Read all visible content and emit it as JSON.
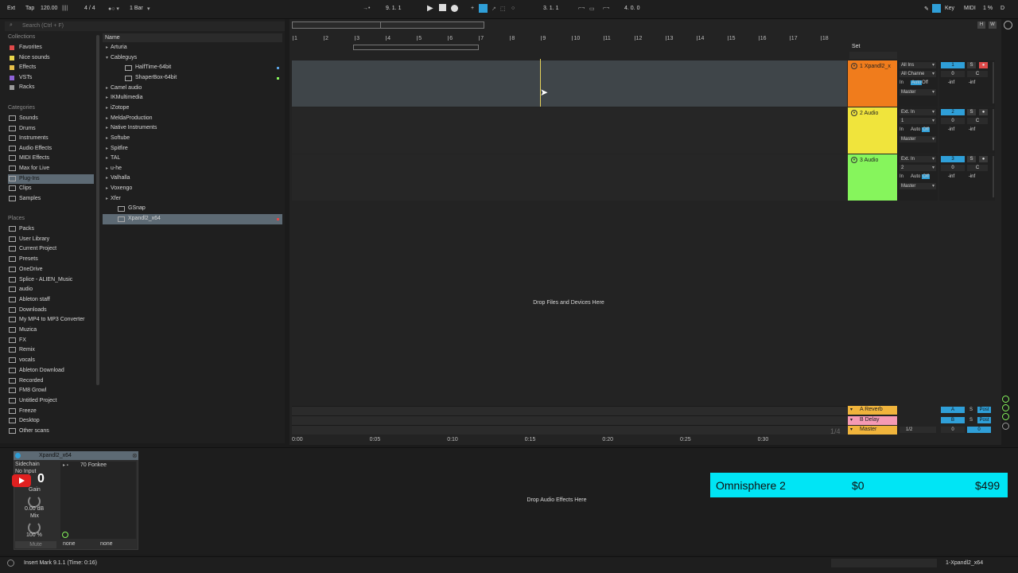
{
  "transport": {
    "ext": "Ext",
    "tap": "Tap",
    "tempo": "120.00",
    "signature": "4 / 4",
    "quantize": "1 Bar",
    "arr_position": "9.  1.  1",
    "loop_start": "3.  1.  1",
    "loop_length": "4.  0.  0",
    "key": "Key",
    "midi": "MIDI",
    "cpu": "1 %",
    "disk": "D"
  },
  "browser": {
    "search_placeholder": "Search (Ctrl + F)",
    "collections_title": "Collections",
    "collections": [
      {
        "label": "Favorites",
        "color": "#e04a4a"
      },
      {
        "label": "Nice sounds",
        "color": "#e8d54a"
      },
      {
        "label": "Effects",
        "color": "#e8c04a"
      },
      {
        "label": "VSTs",
        "color": "#8f63d8"
      },
      {
        "label": "Racks",
        "color": "#9a9a9a"
      }
    ],
    "categories_title": "Categories",
    "categories": [
      "Sounds",
      "Drums",
      "Instruments",
      "Audio Effects",
      "MIDI Effects",
      "Max for Live",
      "Plug-Ins",
      "Clips",
      "Samples"
    ],
    "places_title": "Places",
    "places": [
      "Packs",
      "User Library",
      "Current Project",
      "Presets",
      "OneDrive",
      "Splice - ALIEN_Music",
      "audio",
      "Ableton staff",
      "Downloads",
      "My MP4 to MP3 Converter",
      "Muzica",
      "FX",
      "Remix",
      "vocals",
      "Ableton Download",
      "Recorded",
      "FM8 Growl",
      "Untitled Project",
      "Freeze",
      "Desktop",
      "Other scans"
    ],
    "name_header": "Name",
    "tree": [
      {
        "label": "Arturia",
        "type": "folder",
        "indent": 0
      },
      {
        "label": "Cableguys",
        "type": "open",
        "indent": 0
      },
      {
        "label": "HalfTime-64bit",
        "type": "plugin",
        "indent": 2
      },
      {
        "label": "ShaperBox-64bit",
        "type": "plugin",
        "indent": 2
      },
      {
        "label": "Camel audio",
        "type": "folder",
        "indent": 0
      },
      {
        "label": "IKMultimedia",
        "type": "folder",
        "indent": 0
      },
      {
        "label": "iZotope",
        "type": "folder",
        "indent": 0
      },
      {
        "label": "MeldaProduction",
        "type": "folder",
        "indent": 0
      },
      {
        "label": "Native Instruments",
        "type": "folder",
        "indent": 0
      },
      {
        "label": "Softube",
        "type": "folder",
        "indent": 0
      },
      {
        "label": "Spitfire",
        "type": "folder",
        "indent": 0
      },
      {
        "label": "TAL",
        "type": "folder",
        "indent": 0
      },
      {
        "label": "u-he",
        "type": "folder",
        "indent": 0
      },
      {
        "label": "Valhalla",
        "type": "folder",
        "indent": 0
      },
      {
        "label": "Voxengo",
        "type": "folder",
        "indent": 0
      },
      {
        "label": "Xfer",
        "type": "folder",
        "indent": 0
      },
      {
        "label": "GSnap",
        "type": "plugin",
        "indent": 1
      },
      {
        "label": "Xpandl2_x64",
        "type": "plugin",
        "indent": 1
      }
    ]
  },
  "arrangement": {
    "bars": [
      "1",
      "2",
      "3",
      "4",
      "5",
      "6",
      "7",
      "8",
      "9",
      "10",
      "11",
      "12",
      "13",
      "14",
      "15",
      "16",
      "17",
      "18"
    ],
    "set_label": "Set",
    "drop_text": "Drop Files and Devices Here",
    "times": [
      "0:00",
      "0:05",
      "0:10",
      "0:15",
      "0:20",
      "0:25",
      "0:30"
    ],
    "zoom_ratio": "1/4"
  },
  "tracks": [
    {
      "name": "1 Xpandl2_x",
      "color": "#f07c1c",
      "input": "All Ins",
      "channel": "All Channe",
      "monitor": [
        "In",
        "Auto",
        "Off"
      ],
      "output": "Master",
      "number": "1",
      "vol": "0",
      "pan": "C",
      "peak": "-inf"
    },
    {
      "name": "2 Audio",
      "color": "#f0e43c",
      "input": "Ext. In",
      "channel": "1",
      "monitor": [
        "In",
        "Auto",
        "Off"
      ],
      "output": "Master",
      "number": "2",
      "vol": "0",
      "pan": "C",
      "peak": "-inf"
    },
    {
      "name": "3 Audio",
      "color": "#86f55c",
      "input": "Ext. In",
      "channel": "2",
      "monitor": [
        "In",
        "Auto",
        "Off"
      ],
      "output": "Master",
      "number": "3",
      "vol": "0",
      "pan": "C",
      "peak": "-inf"
    }
  ],
  "returns": [
    {
      "name": "A Reverb",
      "color": "#f0b43c",
      "letter": "A",
      "solo": "S",
      "post": "Post"
    },
    {
      "name": "B Delay",
      "color": "#f59ab4",
      "letter": "B",
      "solo": "S",
      "post": "Post"
    },
    {
      "name": "Master",
      "color": "#f0b43c",
      "output": "1/2",
      "vol": "0",
      "pan": "0"
    }
  ],
  "device": {
    "name": "Xpandl2_x64",
    "sidechain": "Sidechain",
    "sidechain_input": "No Input",
    "gain_label": "Gain",
    "gain_value": "0.00 dB",
    "mix_label": "Mix",
    "mix_value": "100 %",
    "mute": "Mute",
    "preset": "70 Fonkee",
    "slot_a": "none",
    "slot_b": "none"
  },
  "detail": {
    "fx_drop": "Drop Audio Effects Here",
    "overlay": {
      "title": "Omnisphere 2",
      "price_a": "$0",
      "price_b": "$499",
      "color": "#00e5f5"
    },
    "subscriber_count": "0"
  },
  "status": {
    "message": "Insert Mark 9.1.1 (Time: 0:16)",
    "track": "1-Xpandl2_x64"
  }
}
